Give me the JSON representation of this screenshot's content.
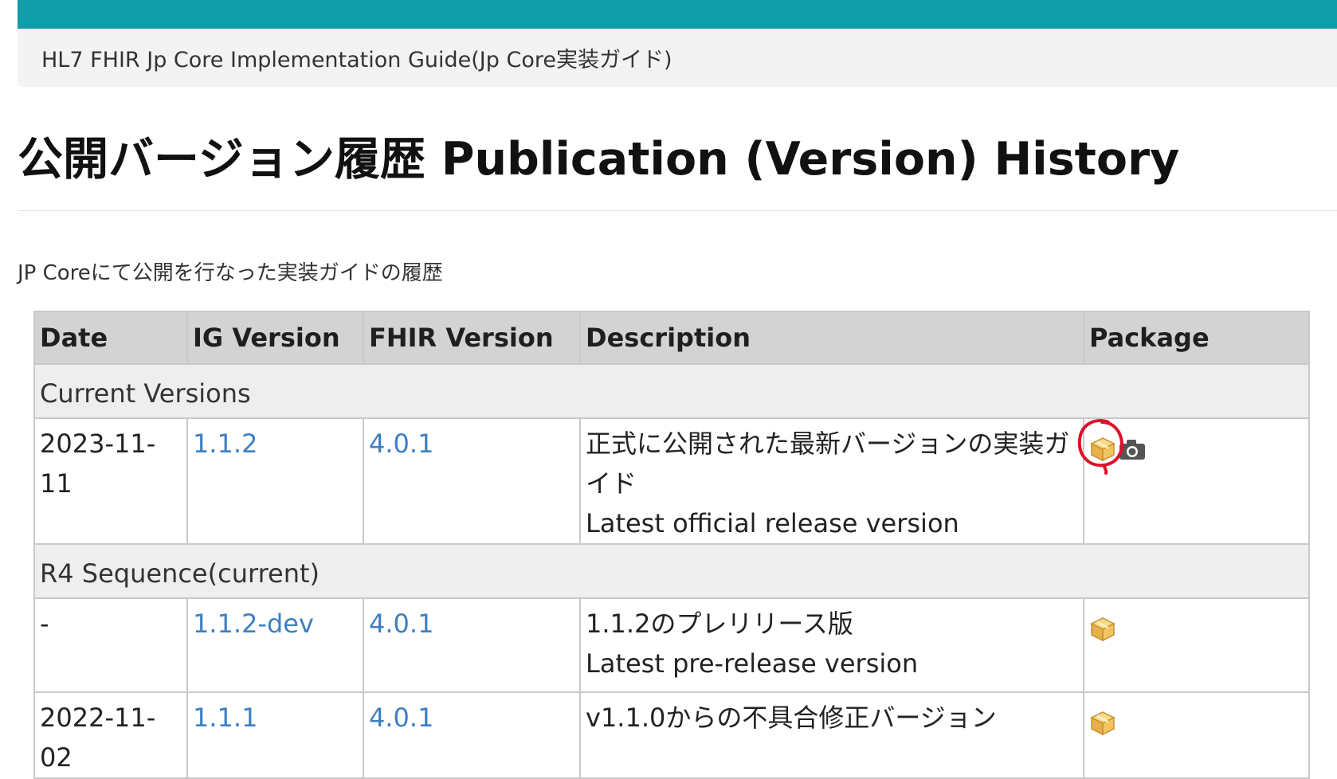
{
  "header": {
    "guide_title": "HL7 FHIR Jp Core Implementation Guide(Jp Core実装ガイド)",
    "accent_color": "#0f9ea8"
  },
  "page": {
    "title": "公開バージョン履歴 Publication (Version) History",
    "intro": "JP Coreにて公開を行なった実装ガイドの履歴"
  },
  "table": {
    "columns": [
      "Date",
      "IG Version",
      "FHIR Version",
      "Description",
      "Package"
    ],
    "sections": [
      {
        "name": "Current Versions",
        "rows": [
          {
            "date": "2023-11-11",
            "ig_version": "1.1.2",
            "fhir_version": "4.0.1",
            "description_jp": "正式に公開された最新バージョンの実装ガイド",
            "description_en": "Latest official release version",
            "package_icons": [
              "package-icon",
              "camera-icon"
            ],
            "package_highlighted": true
          }
        ]
      },
      {
        "name": "R4 Sequence(current)",
        "rows": [
          {
            "date": "-",
            "ig_version": "1.1.2-dev",
            "fhir_version": "4.0.1",
            "description_jp": "1.1.2のプレリリース版",
            "description_en": "Latest pre-release version",
            "package_icons": [
              "package-icon"
            ]
          },
          {
            "date": "2022-11-02",
            "ig_version": "1.1.1",
            "fhir_version": "4.0.1",
            "description_jp": "v1.1.0からの不具合修正バージョン",
            "description_en": "",
            "package_icons": [
              "package-icon"
            ]
          }
        ]
      }
    ]
  },
  "colors": {
    "link": "#3d7fc1",
    "header_bg": "#d3d3d3",
    "section_bg": "#eeeeee",
    "highlight": "#e0102a"
  }
}
